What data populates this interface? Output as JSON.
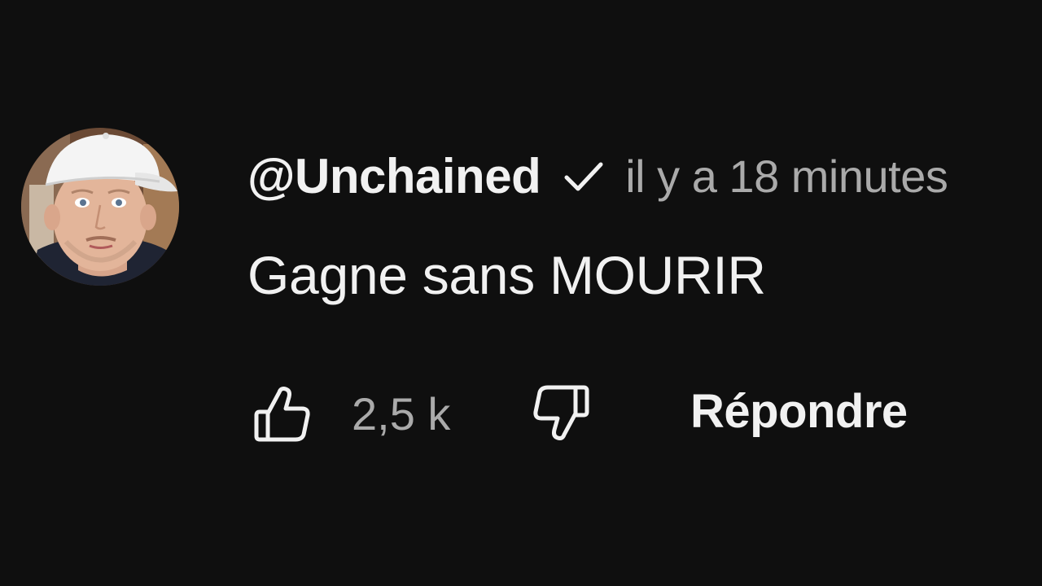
{
  "comment": {
    "author": {
      "username": "@Unchained",
      "verified_icon": "check-icon",
      "avatar": "profile-photo-man-white-cap"
    },
    "timestamp": "il y a 18 minutes",
    "text": "Gagne sans MOURIR",
    "actions": {
      "like_icon": "thumbs-up-icon",
      "like_count": "2,5 k",
      "dislike_icon": "thumbs-down-icon",
      "reply_label": "Répondre"
    }
  },
  "colors": {
    "background": "#0f0f0f",
    "primary_text": "#f1f1f1",
    "secondary_text": "#aaaaaa"
  }
}
